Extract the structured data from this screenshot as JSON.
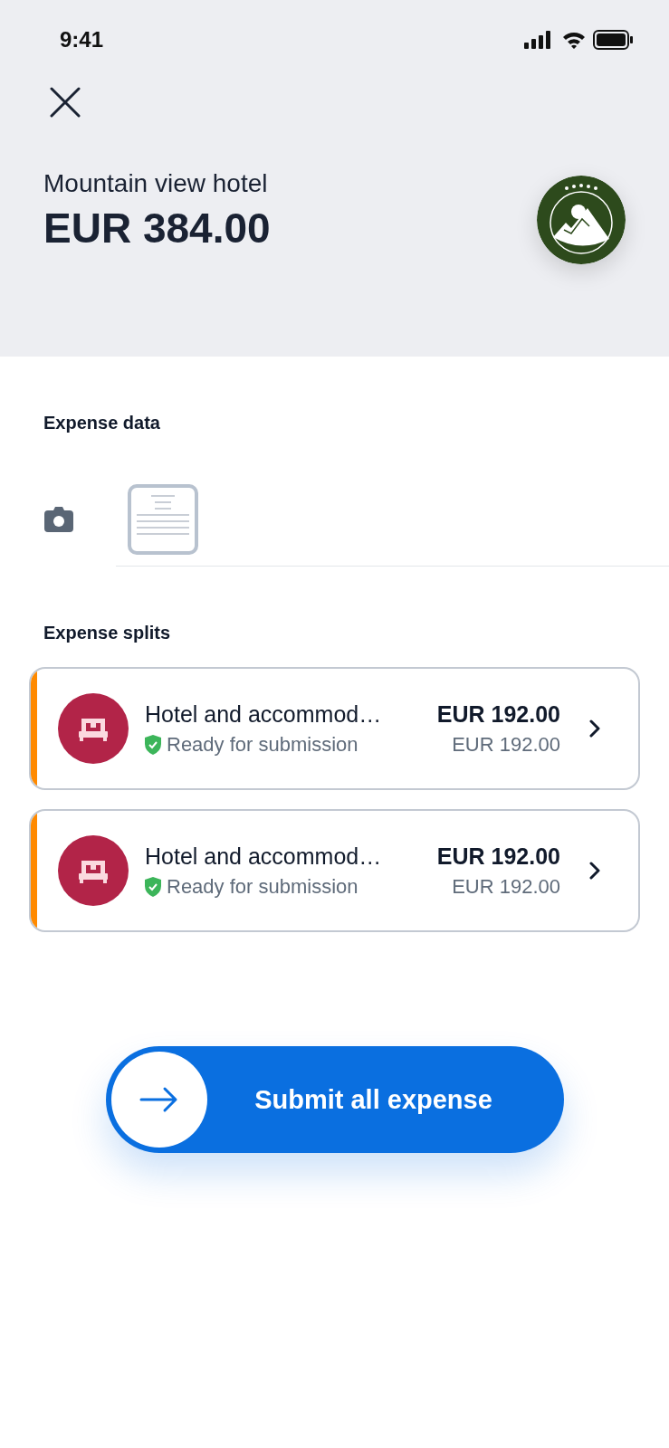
{
  "status_bar": {
    "time": "9:41"
  },
  "header": {
    "merchant": "Mountain view hotel",
    "amount": "EUR 384.00"
  },
  "expense_data": {
    "title": "Expense data"
  },
  "expense_splits": {
    "title": "Expense splits",
    "items": [
      {
        "category": "Hotel and accommod…",
        "status": "Ready for submission",
        "amount": "EUR 192.00",
        "converted_amount": "EUR 192.00",
        "color": "#ff8a00"
      },
      {
        "category": "Hotel and accommod…",
        "status": "Ready for submission",
        "amount": "EUR 192.00",
        "converted_amount": "EUR 192.00",
        "color": "#ff8a00"
      }
    ]
  },
  "submit_button": {
    "label": "Submit all expense"
  }
}
